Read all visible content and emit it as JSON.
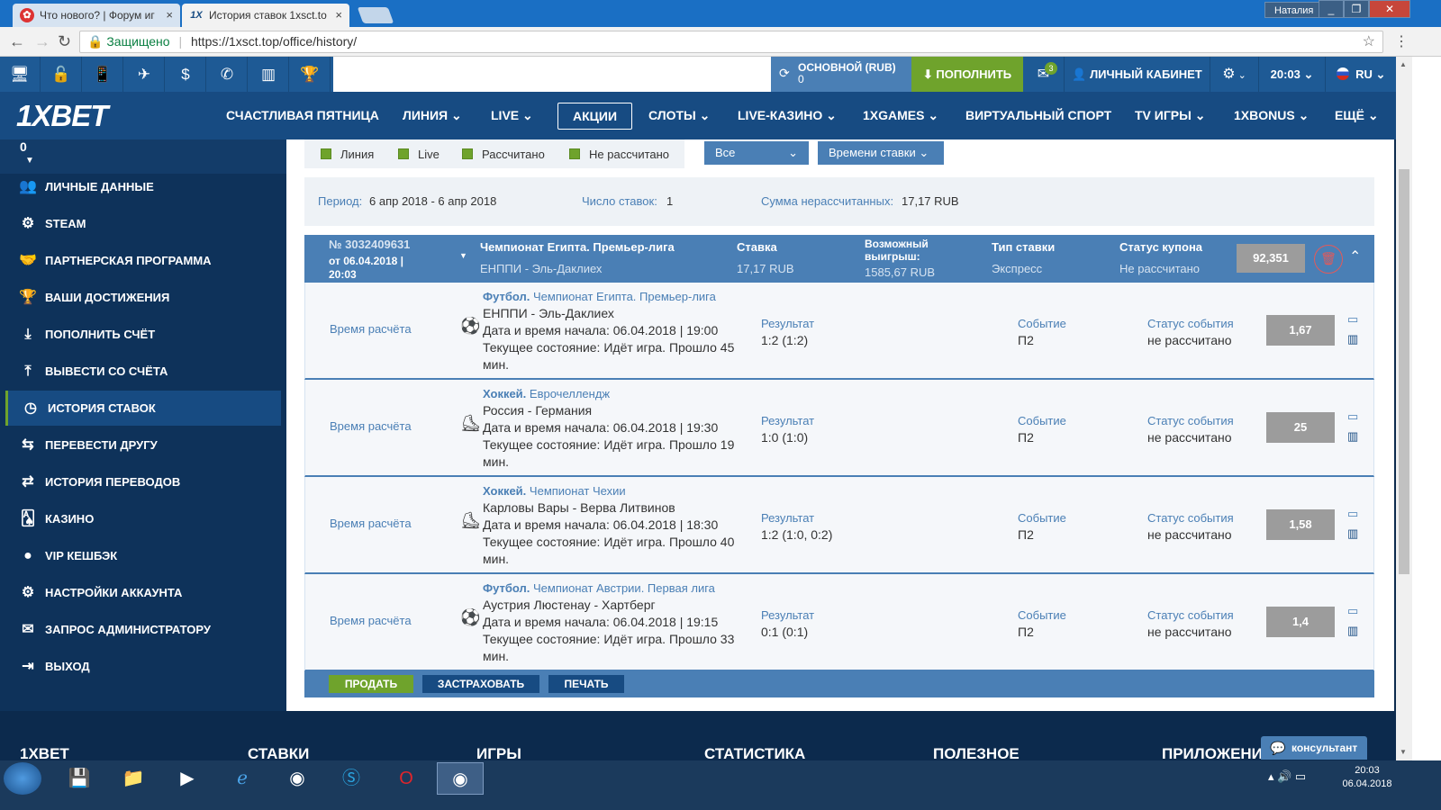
{
  "browser": {
    "tabs": [
      {
        "title": "Что нового? | Форум иг",
        "close": "×"
      },
      {
        "title": "История ставок 1xsct.to",
        "close": "×"
      }
    ],
    "user_label": "Наталия",
    "secure_label": "Защищено",
    "url": "https://1xsct.top/office/history/"
  },
  "topbar": {
    "balance_title": "ОСНОВНОЙ (RUB)",
    "balance_value": "0",
    "deposit_label": "ПОПОЛНИТЬ",
    "mail_count": "3",
    "cabinet_label": "ЛИЧНЫЙ КАБИНЕТ",
    "time": "20:03",
    "lang": "RU"
  },
  "brand": {
    "logo": "1XBET",
    "accent": "#6fa32c",
    "primary": "#174b82",
    "secondary": "#4a7fb5"
  },
  "mainnav": [
    {
      "label": "СЧАСТЛИВАЯ ПЯТНИЦА"
    },
    {
      "label": "ЛИНИЯ ⌄"
    },
    {
      "label": "LIVE ⌄"
    },
    {
      "label": "АКЦИИ"
    },
    {
      "label": "СЛОТЫ ⌄"
    },
    {
      "label": "LIVE-КАЗИНО ⌄"
    },
    {
      "label": "1XGAMES ⌄"
    },
    {
      "label": "ВИРТУАЛЬНЫЙ СПОРТ"
    },
    {
      "label": "TV ИГРЫ ⌄"
    },
    {
      "label": "1XBONUS ⌄"
    },
    {
      "label": "ЕЩЁ ⌄"
    }
  ],
  "sidebar": {
    "top_value": "0",
    "items": [
      {
        "label": "ЛИЧНЫЕ ДАННЫЕ",
        "icon": "user-icon"
      },
      {
        "label": "STEAM",
        "icon": "steam-icon"
      },
      {
        "label": "ПАРТНЕРСКАЯ ПРОГРАММА",
        "icon": "handshake-icon"
      },
      {
        "label": "ВАШИ ДОСТИЖЕНИЯ",
        "icon": "trophy-icon"
      },
      {
        "label": "ПОПОЛНИТЬ СЧЁТ",
        "icon": "download-icon"
      },
      {
        "label": "ВЫВЕСТИ СО СЧЁТА",
        "icon": "upload-icon"
      },
      {
        "label": "ИСТОРИЯ СТАВОК",
        "icon": "clock-icon"
      },
      {
        "label": "ПЕРЕВЕСТИ ДРУГУ",
        "icon": "transfer-icon"
      },
      {
        "label": "ИСТОРИЯ ПЕРЕВОДОВ",
        "icon": "arrows-icon"
      },
      {
        "label": "КАЗИНО",
        "icon": "cards-icon"
      },
      {
        "label": "VIP КЕШБЭК",
        "icon": "dot-icon"
      },
      {
        "label": "НАСТРОЙКИ АККАУНТА",
        "icon": "gears-icon"
      },
      {
        "label": "ЗАПРОС АДМИНИСТРАТОРУ",
        "icon": "mail-icon"
      },
      {
        "label": "ВЫХОД",
        "icon": "exit-icon"
      }
    ]
  },
  "filters": {
    "checkboxes": [
      {
        "label": "Линия",
        "checked": true
      },
      {
        "label": "Live",
        "checked": true
      },
      {
        "label": "Рассчитано",
        "checked": true
      },
      {
        "label": "Не рассчитано",
        "checked": true
      }
    ],
    "type_select": "Все",
    "sort_select": "Времени ставки ⌄"
  },
  "summary": {
    "period_label": "Период:",
    "period_value": "6 апр 2018 - 6 апр 2018",
    "count_label": "Число ставок:",
    "count_value": "1",
    "unsettled_label": "Сумма нерассчитанных:",
    "unsettled_value": "17,17 RUB"
  },
  "coupon": {
    "number": "№ 3032409631",
    "date_line1": "от 06.04.2018 |",
    "date_line2": "20:03",
    "league": "Чемпионат Египта. Премьер-лига",
    "match": "ЕНППИ - Эль-Даклиех",
    "stake_label": "Ставка",
    "stake_value": "17,17 RUB",
    "win_label_1": "Возможный",
    "win_label_2": "выигрыш:",
    "win_value": "1585,67 RUB",
    "type_label": "Тип ставки",
    "type_value": "Экспресс",
    "status_label": "Статус купона",
    "status_value": "Не рассчитано",
    "total_coef": "92,351"
  },
  "bets": [
    {
      "calc": "Время расчёта",
      "sport": "Футбол.",
      "sport_icon": "soccer-ball-icon",
      "league": "Чемпионат Египта. Премьер-лига",
      "match": "ЕНППИ - Эль-Даклиех",
      "start": "Дата и время начала: 06.04.2018 | 19:00",
      "state_1": "Текущее состояние: Идёт игра. Прошло 45",
      "state_2": "мин.",
      "result_label": "Результат",
      "result": "1:2 (1:2)",
      "event_label": "Событие",
      "event": "П2",
      "status_label": "Статус события",
      "status": "не рассчитано",
      "coef": "1,67"
    },
    {
      "calc": "Время расчёта",
      "sport": "Хоккей.",
      "sport_icon": "hockey-skate-icon",
      "league": "Еврочеллендж",
      "match": "Россия - Германия",
      "start": "Дата и время начала: 06.04.2018 | 19:30",
      "state_1": "Текущее состояние: Идёт игра. Прошло 19",
      "state_2": "мин.",
      "result_label": "Результат",
      "result": "1:0 (1:0)",
      "event_label": "Событие",
      "event": "П2",
      "status_label": "Статус события",
      "status": "не рассчитано",
      "coef": "25"
    },
    {
      "calc": "Время расчёта",
      "sport": "Хоккей.",
      "sport_icon": "hockey-skate-icon",
      "league": "Чемпионат Чехии",
      "match": "Карловы Вары - Верва Литвинов",
      "start": "Дата и время начала: 06.04.2018 | 18:30",
      "state_1": "Текущее состояние: Идёт игра. Прошло 40",
      "state_2": "мин.",
      "result_label": "Результат",
      "result": "1:2 (1:0, 0:2)",
      "event_label": "Событие",
      "event": "П2",
      "status_label": "Статус события",
      "status": "не рассчитано",
      "coef": "1,58"
    },
    {
      "calc": "Время расчёта",
      "sport": "Футбол.",
      "sport_icon": "soccer-ball-icon",
      "league": "Чемпионат Австрии. Первая лига",
      "match": "Аустрия Люстенау - Хартберг",
      "start": "Дата и время начала: 06.04.2018 | 19:15",
      "state_1": "Текущее состояние: Идёт игра. Прошло 33",
      "state_2": "мин.",
      "result_label": "Результат",
      "result": "0:1 (0:1)",
      "event_label": "Событие",
      "event": "П2",
      "status_label": "Статус события",
      "status": "не рассчитано",
      "coef": "1,4"
    }
  ],
  "actions": {
    "sell": "ПРОДАТЬ",
    "insure": "ЗАСТРАХОВАТЬ",
    "print": "ПЕЧАТЬ"
  },
  "footer": {
    "columns": [
      "1XBET",
      "СТАВКИ",
      "ИГРЫ",
      "СТАТИСТИКА",
      "ПОЛЕЗНОЕ",
      "ПРИЛОЖЕНИ"
    ],
    "consult": "консультант"
  },
  "taskbar": {
    "time": "20:03",
    "date": "06.04.2018"
  }
}
